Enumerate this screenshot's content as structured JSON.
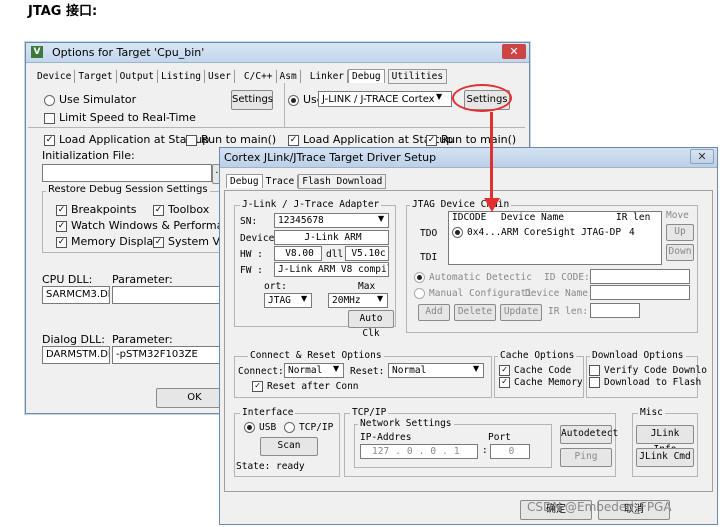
{
  "heading": "JTAG 接口:",
  "outer": {
    "title": "Options for Target 'Cpu_bin'",
    "close": "✕",
    "tabs": [
      "Device",
      "Target",
      "Output",
      "Listing",
      "User",
      "C/C++",
      "Asm",
      "Linker",
      "Debug",
      "Utilities"
    ],
    "use_simulator": "Use Simulator",
    "settings_left": "Settings",
    "limit_speed": "Limit Speed to Real-Time",
    "use_label": "Use:",
    "debugger": "J-LINK / J-TRACE Cortex",
    "settings_right": "Settings",
    "load_app_left": "Load Application at Startup",
    "run_main_left": "Run to main()",
    "load_app_right": "Load Application at Startup",
    "run_main_right": "Run to main()",
    "init_file": "Initialization File:",
    "browse": "...",
    "restore_title": "Restore Debug Session Settings",
    "breakpoints": "Breakpoints",
    "toolbox": "Toolbox",
    "watch_windows": "Watch Windows & Performance Analyzer",
    "memory_display": "Memory Display",
    "system_viewer": "System Viewer",
    "cpu_dll_label": "CPU DLL:",
    "cpu_param_label": "Parameter:",
    "cpu_dll": "SARMCM3.DLL",
    "dialog_dll_label": "Dialog DLL:",
    "dialog_param_label": "Parameter:",
    "dialog_dll": "DARMSTM.DLL",
    "dialog_param": "-pSTM32F103ZE",
    "ok": "OK"
  },
  "inner": {
    "title": "Cortex JLink/JTrace Target Driver Setup",
    "close": "✕",
    "tabs": [
      "Debug",
      "Trace",
      "Flash Download"
    ],
    "adapter_title": "J-Link / J-Trace Adapter",
    "sn_label": "SN:",
    "sn": "12345678",
    "device_label": "Device:",
    "device": "J-Link ARM",
    "hw_label": "HW :",
    "hw": "V8.00",
    "dll_label": "dll",
    "dll": "V5.10c",
    "fw_label": "FW :",
    "fw": "J-Link ARM V8 compiled I",
    "port_label": "ort:",
    "port": "JTAG",
    "max_label": "Max",
    "max": "20MHz",
    "auto_clk": "Auto Clk",
    "chain_title": "JTAG Device Chain",
    "col_idcode": "IDCODE",
    "col_device": "Device Name",
    "col_irlen": "IR len",
    "tdo": "TDO",
    "tdi": "TDI",
    "row_idcode": "0x4...",
    "row_device": "ARM CoreSight JTAG-DP",
    "row_irlen": "4",
    "move": "Move",
    "up": "Up",
    "down": "Down",
    "auto_detect": "Automatic Detectic",
    "manual_config": "Manual Configurati",
    "id_code": "ID CODE:",
    "device_name": "Device Name:",
    "add": "Add",
    "delete": "Delete",
    "update": "Update",
    "ir_len": "IR len:",
    "connect_title": "Connect & Reset Options",
    "connect_label": "Connect:",
    "connect": "Normal",
    "reset_label": "Reset:",
    "reset": "Normal",
    "reset_after": "Reset after Conn",
    "cache_title": "Cache Options",
    "cache_code": "Cache Code",
    "cache_memory": "Cache Memory",
    "download_title": "Download Options",
    "verify_code": "Verify Code Downlo",
    "download_flash": "Download to Flash",
    "interface_title": "Interface",
    "usb": "USB",
    "tcpip": "TCP/IP",
    "scan": "Scan",
    "state": "State: ready",
    "tcpip_title": "TCP/IP",
    "network_title": "Network Settings",
    "ip_label": "IP-Addres",
    "port_num_label": "Port",
    "ip": [
      "127",
      "0",
      "0",
      "1"
    ],
    "port_num": "0",
    "autodetect": "Autodetect",
    "ping": "Ping",
    "misc_title": "Misc",
    "jlink_info": "JLink Info",
    "jlink_cmd": "JLink Cmd",
    "ok": "确定",
    "cancel": "取消"
  },
  "watermark": "CSDN @Embeded_FPGA",
  "colors": {
    "annotation": "#e03030",
    "titlebar": "#c3d6ec"
  }
}
